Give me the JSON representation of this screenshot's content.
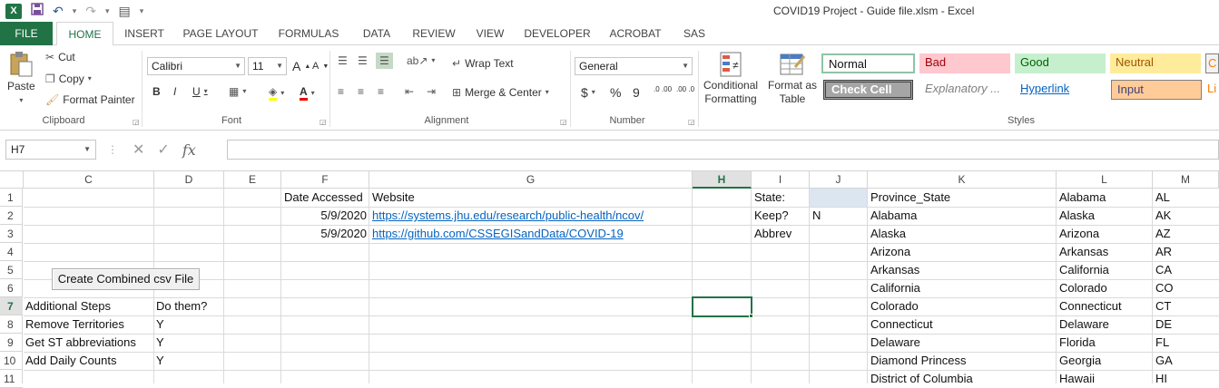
{
  "window": {
    "title": "COVID19 Project - Guide file.xlsm - Excel"
  },
  "qat": {
    "logo": "X",
    "save_icon": "save-icon",
    "undo_icon": "undo-icon",
    "redo_icon": "redo-icon"
  },
  "tabs": [
    "FILE",
    "HOME",
    "INSERT",
    "PAGE LAYOUT",
    "FORMULAS",
    "DATA",
    "REVIEW",
    "VIEW",
    "DEVELOPER",
    "ACROBAT",
    "SAS"
  ],
  "ribbon": {
    "clipboard": {
      "label": "Clipboard",
      "paste": "Paste",
      "cut": "Cut",
      "copy": "Copy",
      "format_painter": "Format Painter"
    },
    "font": {
      "label": "Font",
      "name": "Calibri",
      "size": "11",
      "bold": "B",
      "italic": "I",
      "underline": "U",
      "grow": "A",
      "shrink": "A"
    },
    "alignment": {
      "label": "Alignment",
      "wrap": "Wrap Text",
      "merge": "Merge & Center"
    },
    "number": {
      "label": "Number",
      "format": "General",
      "currency": "$",
      "percent": "%",
      "comma": "9",
      "inc_dec": ".0 .00",
      "dec_dec": ".00 .0"
    },
    "styles": {
      "label": "Styles",
      "conditional": [
        "Conditional",
        "Formatting"
      ],
      "format_as_table": [
        "Format as",
        "Table"
      ],
      "normal": "Normal",
      "bad": "Bad",
      "good": "Good",
      "neutral": "Neutral",
      "calc": "C",
      "check_cell": "Check Cell",
      "explanatory": "Explanatory ...",
      "hyperlink": "Hyperlink",
      "input": "Input",
      "linked": "Li"
    }
  },
  "formula_bar": {
    "name_box": "H7",
    "cancel": "✕",
    "enter": "✓",
    "fx": "fx",
    "value": ""
  },
  "columns": [
    "C",
    "D",
    "E",
    "F",
    "G",
    "H",
    "I",
    "J",
    "K",
    "L",
    "M"
  ],
  "selected_column": "H",
  "rows": [
    "1",
    "2",
    "3",
    "4",
    "5",
    "6",
    "7",
    "8",
    "9",
    "10",
    "11"
  ],
  "selected_row": "7",
  "cells": {
    "F1": "Date Accessed",
    "G1": "Website",
    "I1": "State:",
    "K1": "Province_State",
    "L1": "Alabama",
    "M1": "AL",
    "F2": "5/9/2020",
    "G2": "https://systems.jhu.edu/research/public-health/ncov/",
    "I2": "Keep?",
    "J2": "N",
    "K2": "Alabama",
    "L2": "Alaska",
    "M2": "AK",
    "F3": "5/9/2020",
    "G3": "https://github.com/CSSEGISandData/COVID-19",
    "I3": "Abbrev",
    "K3": "Alaska",
    "L3": "Arizona",
    "M3": "AZ",
    "K4": "Arizona",
    "L4": "Arkansas",
    "M4": "AR",
    "K5": "Arkansas",
    "L5": "California",
    "M5": "CA",
    "K6": "California",
    "L6": "Colorado",
    "M6": "CO",
    "C7": "Additional Steps",
    "D7": "Do them?",
    "K7": "Colorado",
    "L7": "Connecticut",
    "M7": "CT",
    "C8": "Remove Territories",
    "D8": "Y",
    "K8": "Connecticut",
    "L8": "Delaware",
    "M8": "DE",
    "C9": "Get ST abbreviations",
    "D9": "Y",
    "K9": "Delaware",
    "L9": "Florida",
    "M9": "FL",
    "C10": "Add Daily Counts",
    "D10": "Y",
    "K10": "Diamond Princess",
    "L10": "Georgia",
    "M10": "GA",
    "K11": "District of Columbia",
    "L11": "Hawaii",
    "M11": "HI"
  },
  "macro_button": {
    "label": "Create Combined csv File"
  },
  "colors": {
    "accent": "#217346",
    "link": "#0563c1",
    "bad_bg": "#ffc7ce",
    "good_bg": "#c6efce",
    "neutral_bg": "#ffeb9c",
    "input_bg": "#ffcc99"
  }
}
